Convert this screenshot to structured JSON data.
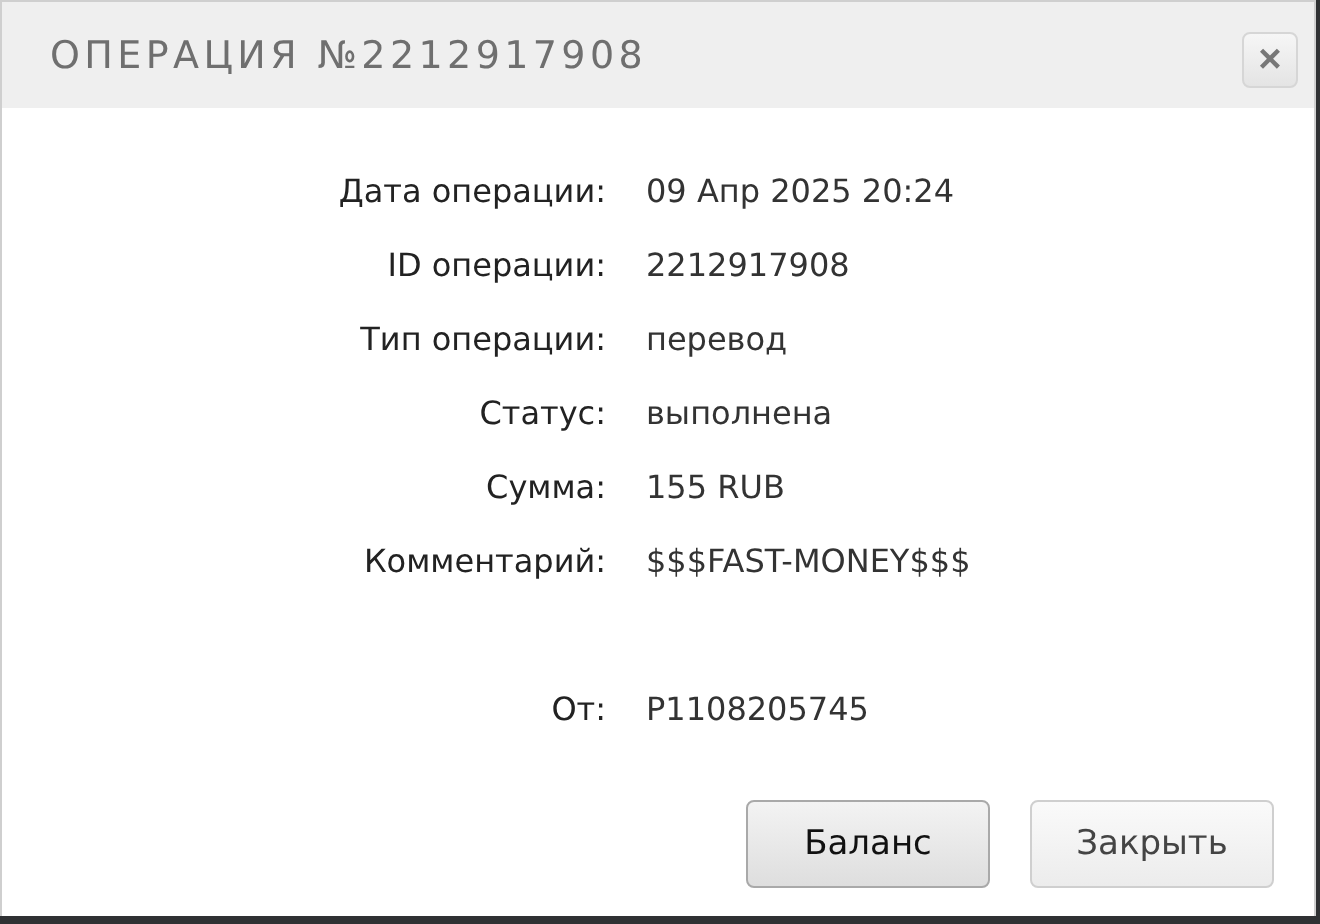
{
  "dialog": {
    "title": "ОПЕРАЦИЯ №2212917908",
    "close": "×"
  },
  "rows": [
    {
      "label": "Дата операции:",
      "value": "09 Апр 2025 20:24"
    },
    {
      "label": "ID операции:",
      "value": "2212917908"
    },
    {
      "label": "Тип операции:",
      "value": "перевод"
    },
    {
      "label": "Статус:",
      "value": "выполнена"
    },
    {
      "label": "Сумма:",
      "value": "155 RUB"
    },
    {
      "label": "Комментарий:",
      "value": "$$$FAST-MONEY$$$"
    }
  ],
  "sender": {
    "label": "От:",
    "value": "P1108205745"
  },
  "buttons": [
    {
      "label": "Баланс",
      "default": true
    },
    {
      "label": "Закрыть",
      "default": false
    }
  ]
}
